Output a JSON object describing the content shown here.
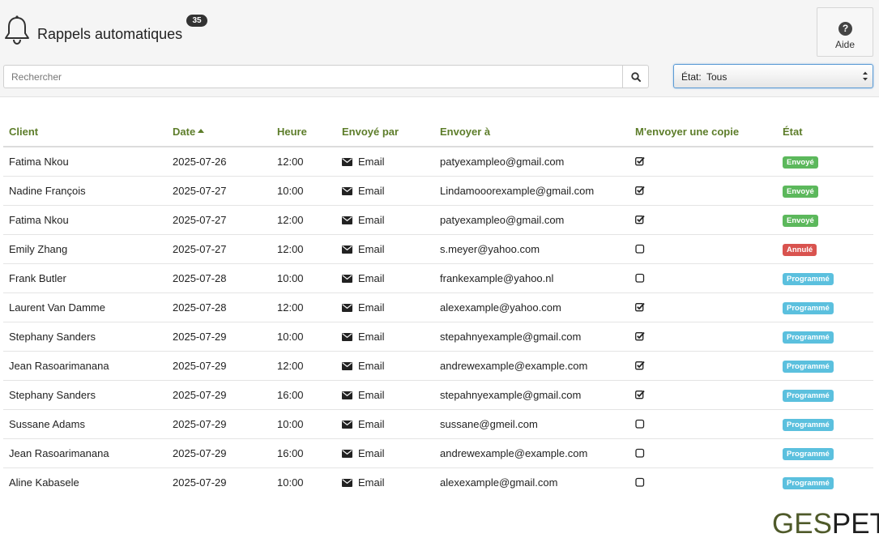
{
  "header": {
    "title": "Rappels automatiques",
    "count": "35",
    "bell_icon": "bell-icon"
  },
  "help": {
    "label": "Aide",
    "icon_char": "?",
    "icon": "question-circle-icon"
  },
  "search": {
    "placeholder": "Rechercher",
    "value": "",
    "icon": "search-icon"
  },
  "state_filter": {
    "label": "État:",
    "selected": "Tous"
  },
  "table": {
    "columns": [
      "Client",
      "Date",
      "Heure",
      "Envoyé par",
      "Envoyer à",
      "M'envoyer une copie",
      "État"
    ],
    "sorted_column": "Date",
    "sort_direction": "asc",
    "rows": [
      {
        "client": "Fatima Nkou",
        "date": "2025-07-26",
        "time": "12:00",
        "sent_by": "Email",
        "send_to": "patyexampleo@gmail.com",
        "copy": true,
        "status": "Envoyé",
        "status_kind": "sent"
      },
      {
        "client": "Nadine François",
        "date": "2025-07-27",
        "time": "10:00",
        "sent_by": "Email",
        "send_to": "Lindamooorexample@gmail.com",
        "copy": true,
        "status": "Envoyé",
        "status_kind": "sent"
      },
      {
        "client": "Fatima Nkou",
        "date": "2025-07-27",
        "time": "12:00",
        "sent_by": "Email",
        "send_to": "patyexampleo@gmail.com",
        "copy": true,
        "status": "Envoyé",
        "status_kind": "sent"
      },
      {
        "client": "Emily Zhang",
        "date": "2025-07-27",
        "time": "12:00",
        "sent_by": "Email",
        "send_to": "s.meyer@yahoo.com",
        "copy": false,
        "status": "Annulé",
        "status_kind": "cancelled"
      },
      {
        "client": "Frank Butler",
        "date": "2025-07-28",
        "time": "10:00",
        "sent_by": "Email",
        "send_to": "frankexample@yahoo.nl",
        "copy": false,
        "status": "Programmé",
        "status_kind": "scheduled"
      },
      {
        "client": "Laurent Van Damme",
        "date": "2025-07-28",
        "time": "12:00",
        "sent_by": "Email",
        "send_to": "alexexample@yahoo.com",
        "copy": true,
        "status": "Programmé",
        "status_kind": "scheduled"
      },
      {
        "client": "Stephany Sanders",
        "date": "2025-07-29",
        "time": "10:00",
        "sent_by": "Email",
        "send_to": "stepahnyexample@gmail.com",
        "copy": true,
        "status": "Programmé",
        "status_kind": "scheduled"
      },
      {
        "client": "Jean Rasoarimanana",
        "date": "2025-07-29",
        "time": "12:00",
        "sent_by": "Email",
        "send_to": "andrewexample@example.com",
        "copy": true,
        "status": "Programmé",
        "status_kind": "scheduled"
      },
      {
        "client": "Stephany Sanders",
        "date": "2025-07-29",
        "time": "16:00",
        "sent_by": "Email",
        "send_to": "stepahnyexample@gmail.com",
        "copy": true,
        "status": "Programmé",
        "status_kind": "scheduled"
      },
      {
        "client": "Sussane Adams",
        "date": "2025-07-29",
        "time": "10:00",
        "sent_by": "Email",
        "send_to": "sussane@gmeil.com",
        "copy": false,
        "status": "Programmé",
        "status_kind": "scheduled"
      },
      {
        "client": "Jean Rasoarimanana",
        "date": "2025-07-29",
        "time": "16:00",
        "sent_by": "Email",
        "send_to": "andrewexample@example.com",
        "copy": false,
        "status": "Programmé",
        "status_kind": "scheduled"
      },
      {
        "client": "Aline Kabasele",
        "date": "2025-07-29",
        "time": "10:00",
        "sent_by": "Email",
        "send_to": "alexexample@gmail.com",
        "copy": false,
        "status": "Programmé",
        "status_kind": "scheduled"
      }
    ]
  },
  "status_colors": {
    "sent": "#5cb85c",
    "cancelled": "#d9534f",
    "scheduled": "#5bc0de"
  },
  "colors": {
    "header_text": "#5d7d2a",
    "topbar_bg": "#f5f5f5"
  },
  "logo": {
    "part1": "GES",
    "part2": "PET"
  }
}
